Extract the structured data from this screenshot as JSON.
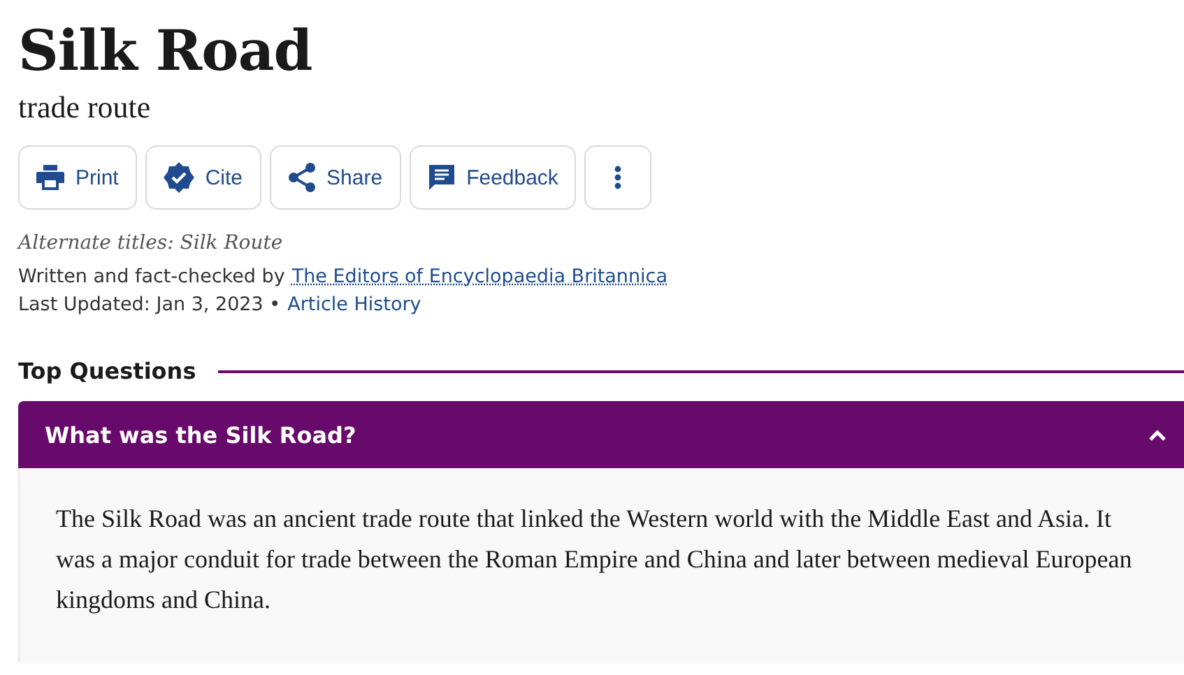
{
  "title": "Silk Road",
  "subtitle": "trade route",
  "actions": [
    {
      "kind": "print",
      "label": "Print"
    },
    {
      "kind": "cite",
      "label": "Cite"
    },
    {
      "kind": "share",
      "label": "Share"
    },
    {
      "kind": "feedback",
      "label": "Feedback"
    },
    {
      "kind": "more"
    }
  ],
  "alternate_titles": "Alternate titles: Silk Route",
  "byline": {
    "text": "Written and fact-checked by",
    "link": "The Editors of Encyclopaedia Britannica"
  },
  "updated": {
    "text": "Last Updated: Jan 3, 2023 •",
    "link": "Article History"
  },
  "top_questions": {
    "heading": "Top Questions",
    "items": [
      {
        "question": "What was the Silk Road?",
        "expanded": true,
        "answer": "The Silk Road was an ancient trade route that linked the Western world with the Middle East and Asia. It was a major conduit for trade between the Roman Empire and China and later between medieval European kingdoms and China."
      }
    ]
  }
}
